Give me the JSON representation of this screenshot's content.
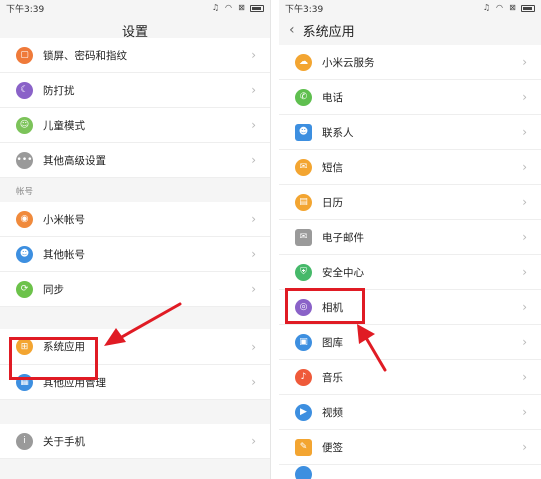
{
  "status": {
    "time": "下午3:39"
  },
  "left": {
    "title": "设置",
    "items_a": [
      {
        "label": "锁屏、密码和指纹",
        "icon": "lock-icon",
        "color": "#ef7a3a"
      },
      {
        "label": "防打扰",
        "icon": "moon-icon",
        "color": "#8a62c8"
      },
      {
        "label": "儿童模式",
        "icon": "child-mode-icon",
        "color": "#7cc35a"
      },
      {
        "label": "其他高级设置",
        "icon": "more-dots-icon",
        "color": "#9a9a9a"
      }
    ],
    "section_label": "帐号",
    "items_b": [
      {
        "label": "小米帐号",
        "icon": "mi-account-icon",
        "color": "#f08a3c"
      },
      {
        "label": "其他帐号",
        "icon": "person-icon",
        "color": "#3d8fe0"
      },
      {
        "label": "同步",
        "icon": "sync-icon",
        "color": "#6cc24a"
      }
    ],
    "items_c": [
      {
        "label": "系统应用",
        "icon": "apps-icon",
        "color": "#f3a531"
      },
      {
        "label": "其他应用管理",
        "icon": "grid-icon",
        "color": "#3d8fe0"
      }
    ],
    "items_d": [
      {
        "label": "关于手机",
        "icon": "info-icon",
        "color": "#9a9a9a"
      }
    ]
  },
  "right": {
    "title": "系统应用",
    "items": [
      {
        "label": "小米云服务",
        "icon": "cloud-icon",
        "color": "#f3a531"
      },
      {
        "label": "电话",
        "icon": "phone-icon",
        "color": "#5fbf4f"
      },
      {
        "label": "联系人",
        "icon": "contacts-icon",
        "color": "#3d8fe0"
      },
      {
        "label": "短信",
        "icon": "message-icon",
        "color": "#f3a531"
      },
      {
        "label": "日历",
        "icon": "calendar-icon",
        "color": "#f3a531"
      },
      {
        "label": "电子邮件",
        "icon": "mail-icon",
        "color": "#9a9a9a"
      },
      {
        "label": "安全中心",
        "icon": "shield-icon",
        "color": "#46b96a"
      },
      {
        "label": "相机",
        "icon": "camera-icon",
        "color": "#8a62c8"
      },
      {
        "label": "图库",
        "icon": "gallery-icon",
        "color": "#3d8fe0"
      },
      {
        "label": "音乐",
        "icon": "music-icon",
        "color": "#ef5a3a"
      },
      {
        "label": "视频",
        "icon": "video-icon",
        "color": "#3d8fe0"
      },
      {
        "label": "便签",
        "icon": "notes-icon",
        "color": "#f3a531"
      }
    ]
  },
  "accent": {
    "highlight": "#e01b24",
    "chevron": "#b8b8b8"
  }
}
